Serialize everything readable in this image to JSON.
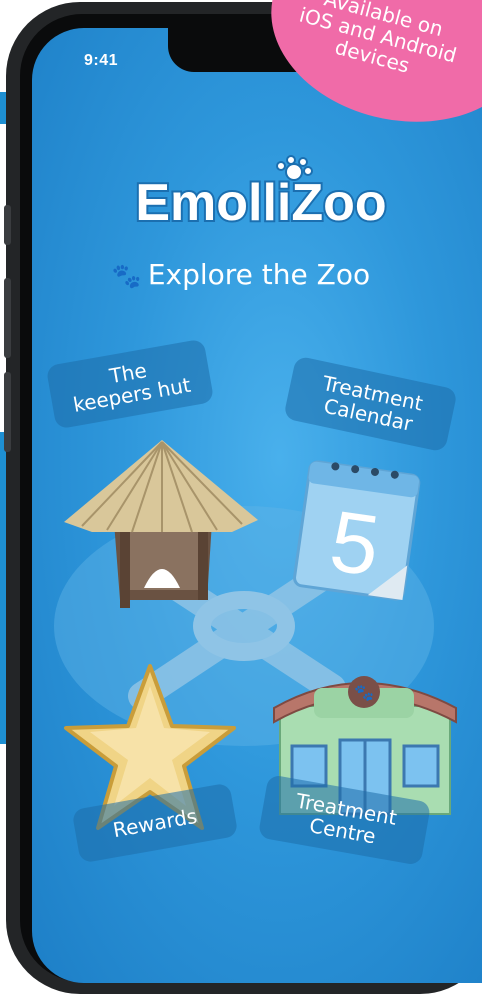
{
  "status_bar": {
    "time": "9:41"
  },
  "app": {
    "logo_text": "EmolliZoo",
    "subtitle": "Explore the Zoo"
  },
  "promo_badge": {
    "line1": "Available on",
    "line2": "iOS and Android",
    "line3": "devices",
    "color": "#f06ba8"
  },
  "menu": {
    "keepers_hut": {
      "line1": "The",
      "line2": "keepers hut"
    },
    "calendar": {
      "line1": "Treatment",
      "line2": "Calendar",
      "day_number": "5"
    },
    "rewards": {
      "label": "Rewards"
    },
    "centre": {
      "line1": "Treatment",
      "line2": "Centre"
    }
  },
  "colors": {
    "background": "#2e97db",
    "label_box": "#1e6eaa",
    "logo_fill": "#ffffff"
  }
}
